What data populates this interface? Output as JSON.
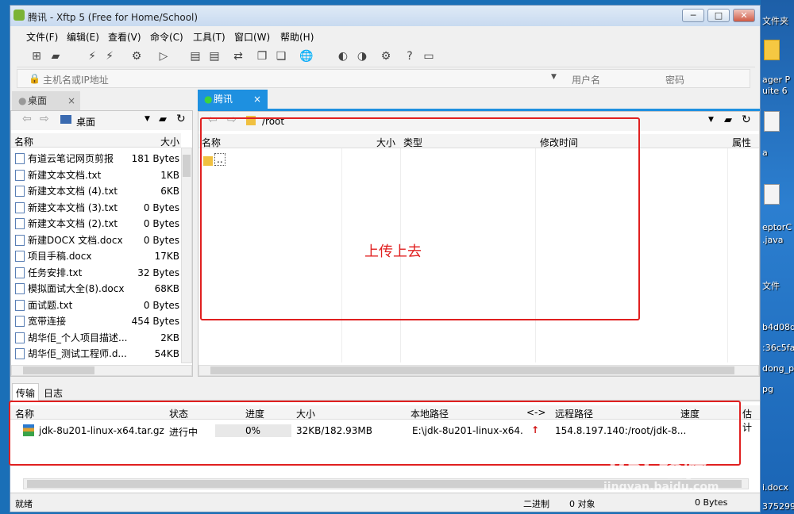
{
  "window": {
    "icon": "xftp-icon",
    "title": "腾讯    - Xftp 5 (Free for Home/School)",
    "controls": [
      "─",
      "□",
      "✕"
    ]
  },
  "menu": [
    "文件(F)",
    "编辑(E)",
    "查看(V)",
    "命令(C)",
    "工具(T)",
    "窗口(W)",
    "帮助(H)"
  ],
  "address": {
    "host_placeholder": "主机名或IP地址",
    "user_placeholder": "用户名",
    "pass_placeholder": "密码"
  },
  "left": {
    "tab": "桌面",
    "path": "桌面",
    "cols": [
      "名称",
      "大小"
    ],
    "files": [
      {
        "name": "有道云笔记网页剪报",
        "size": "181 Bytes"
      },
      {
        "name": "新建文本文档.txt",
        "size": "1KB"
      },
      {
        "name": "新建文本文档 (4).txt",
        "size": "6KB"
      },
      {
        "name": "新建文本文档 (3).txt",
        "size": "0 Bytes"
      },
      {
        "name": "新建文本文档 (2).txt",
        "size": "0 Bytes"
      },
      {
        "name": "新建DOCX 文档.docx",
        "size": "0 Bytes"
      },
      {
        "name": "项目手稿.docx",
        "size": "17KB"
      },
      {
        "name": "任务安排.txt",
        "size": "32 Bytes"
      },
      {
        "name": "模拟面试大全(8).docx",
        "size": "68KB"
      },
      {
        "name": "面试题.txt",
        "size": "0 Bytes"
      },
      {
        "name": "宽带连接",
        "size": "454 Bytes"
      },
      {
        "name": "胡华佢_个人项目描述...",
        "size": "2KB"
      },
      {
        "name": "胡华佢_测试工程师.d...",
        "size": "54KB"
      }
    ]
  },
  "right": {
    "tab": "腾讯",
    "path": "/root",
    "cols": [
      "名称",
      "大小",
      "类型",
      "修改时间",
      "属性"
    ],
    "parent": "..",
    "annotation": "上传上去"
  },
  "transfer": {
    "tabs": [
      "传输",
      "日志"
    ],
    "cols": [
      "名称",
      "状态",
      "进度",
      "大小",
      "本地路径",
      "<->",
      "远程路径",
      "速度",
      "估计"
    ],
    "row": {
      "name": "jdk-8u201-linux-x64.tar.gz",
      "status": "进行中",
      "progress": "0%",
      "progress_value": 0,
      "size": "32KB/182.93MB",
      "local": "E:\\jdk-8u201-linux-x64.",
      "dir": "↑",
      "remote": "154.8.197.140:/root/jdk-8..."
    }
  },
  "status": {
    "left": "就绪",
    "mode": "二进制",
    "objects": "0 对象",
    "bytes": "0 Bytes"
  },
  "desktop": [
    "文件夹",
    "ager P",
    "uite 6",
    "a",
    "eptorC",
    ".java",
    "文件",
    "b4d08d",
    ":36c5fa",
    "dong_p",
    "pg",
    "i.docx",
    "375299"
  ],
  "watermark": {
    "brand": "Bai  经验",
    "url": "jingyan.baidu.com"
  },
  "colors": {
    "accent": "#1e90e0",
    "annotation": "#e02020"
  }
}
